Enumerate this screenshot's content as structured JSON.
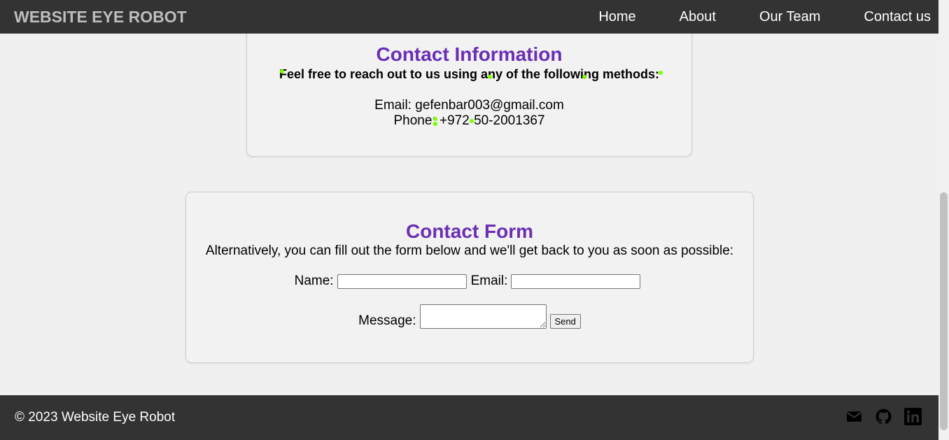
{
  "header": {
    "brand": "WEBSITE EYE ROBOT",
    "nav": [
      "Home",
      "About",
      "Our Team",
      "Contact us"
    ]
  },
  "contact_info": {
    "title": "Contact Information",
    "lead": "Feel free to reach out to us using any of the following methods:",
    "email_label": "Email:",
    "email": "gefenbar003@gmail.com",
    "phone_label": "Phone:",
    "phone": "+972-50-2001367"
  },
  "contact_form": {
    "title": "Contact Form",
    "lead": "Alternatively, you can fill out the form below and we'll get back to you as soon as possible:",
    "name_label": "Name:",
    "name_value": "",
    "email_label": "Email:",
    "email_value": "",
    "message_label": "Message:",
    "message_value": "",
    "send_label": "Send"
  },
  "footer": {
    "copyright": "© 2023 Website Eye Robot",
    "icons": [
      "mail-icon",
      "github-icon",
      "linkedin-icon"
    ]
  },
  "colors": {
    "header_bg": "#333333",
    "heading": "#6a2fb3",
    "page_bg": "#f0f0f0"
  }
}
